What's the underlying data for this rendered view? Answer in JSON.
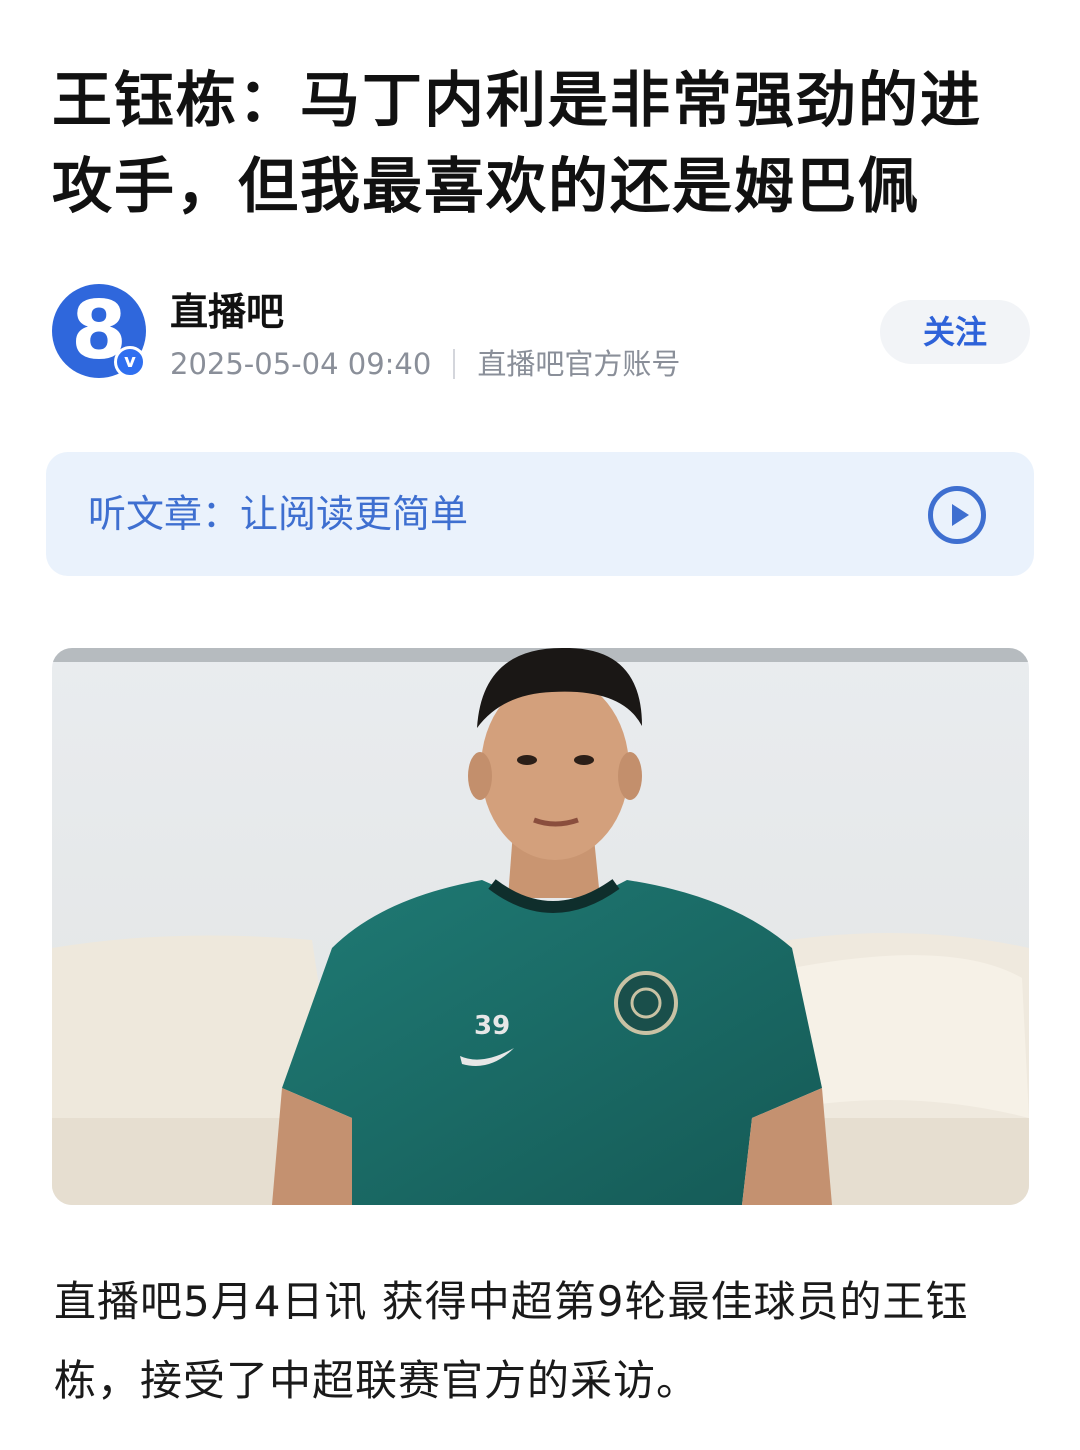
{
  "article": {
    "title": "王钰栋：马丁内利是非常强劲的进攻手，但我最喜欢的还是姆巴佩",
    "author": {
      "name": "直播吧",
      "avatar_text": "8",
      "badge_text": "v",
      "timestamp": "2025-05-04 09:40",
      "account_type": "直播吧官方账号"
    },
    "follow_label": "关注",
    "listen_bar": {
      "label": "听文章：让阅读更简单",
      "icon": "play-icon"
    },
    "image": {
      "jersey_number": "39"
    },
    "body": "直播吧5月4日讯 获得中超第9轮最佳球员的王钰栋，接受了中超联赛官方的采访。"
  },
  "colors": {
    "accent": "#3e6fd0",
    "listen_bg": "#eaf2fc",
    "avatar": "#2f67dc",
    "jersey": "#1f6f6a"
  }
}
